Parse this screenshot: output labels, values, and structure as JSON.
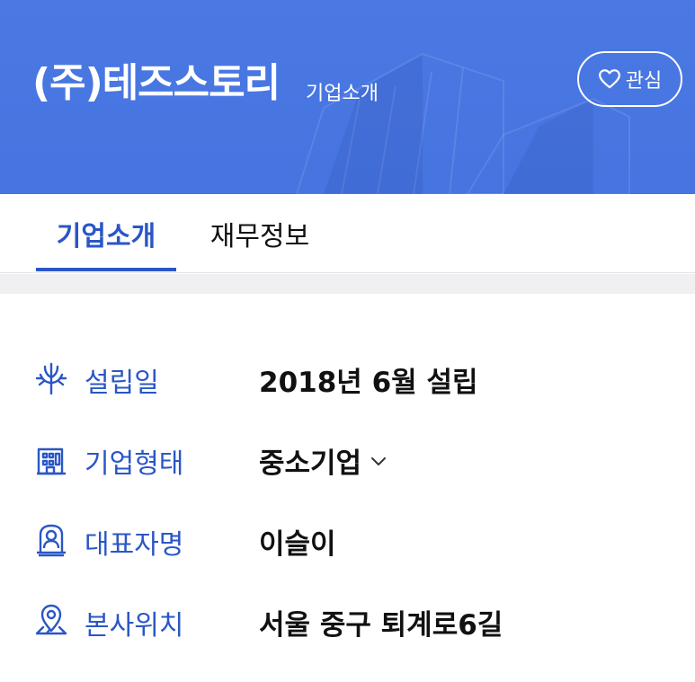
{
  "header": {
    "company_name": "(주)테즈스토리",
    "section_title": "기업소개",
    "favorite_label": "관심"
  },
  "tabs": [
    {
      "label": "기업소개",
      "active": true
    },
    {
      "label": "재무정보",
      "active": false
    }
  ],
  "info": [
    {
      "icon": "sprout-icon",
      "label": "설립일",
      "value": "2018년 6월 설립"
    },
    {
      "icon": "building-icon",
      "label": "기업형태",
      "value": "중소기업"
    },
    {
      "icon": "person-portrait-icon",
      "label": "대표자명",
      "value": "이슬이"
    },
    {
      "icon": "location-pin-icon",
      "label": "본사위치",
      "value": "서울 중구 퇴계로6길"
    }
  ],
  "colors": {
    "header_bg": "#4a79e3",
    "accent": "#2a56c6",
    "band": "#f0f0f2"
  }
}
